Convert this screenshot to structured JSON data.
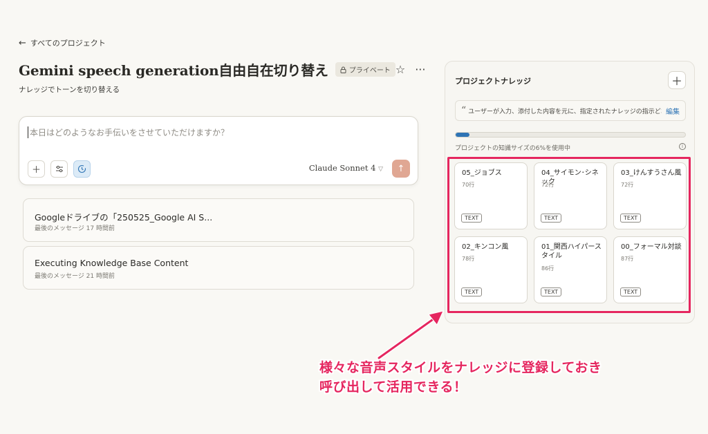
{
  "nav": {
    "back_label": "すべてのプロジェクト"
  },
  "project": {
    "title": "Gemini speech generation自由自在切り替え",
    "badge": "プライベート",
    "subtitle": "ナレッジでトーンを切り替える"
  },
  "composer": {
    "placeholder": "本日はどのようなお手伝いをさせていただけますか？",
    "model": "Claude Sonnet 4",
    "send_icon": "arrow-up-icon"
  },
  "chats": [
    {
      "title": "Googleドライブの「250525_Google AI S...",
      "meta": "最後のメッセージ 17 時間前"
    },
    {
      "title": "Executing Knowledge Base Content",
      "meta": "最後のメッセージ 21 時間前"
    }
  ],
  "knowledge": {
    "title": "プロジェクトナレッジ",
    "instruction": "ユーザーが入力、添付した内容を元に、指定されたナレッジの指示どおり出力...",
    "edit_label": "編集",
    "usage_percent": 6,
    "usage_text": "プロジェクトの知識サイズの6%を使用中",
    "files": [
      {
        "name": "05_ジョブス",
        "lines": "70行",
        "type": "TEXT"
      },
      {
        "name": "04_サイモン･シネック",
        "lines": "72行",
        "type": "TEXT"
      },
      {
        "name": "03_けんすうさん風",
        "lines": "72行",
        "type": "TEXT"
      },
      {
        "name": "02_キンコン風",
        "lines": "78行",
        "type": "TEXT"
      },
      {
        "name": "01_関西ハイパースタイル",
        "lines": "86行",
        "type": "TEXT"
      },
      {
        "name": "00_フォーマル対談",
        "lines": "87行",
        "type": "TEXT"
      }
    ]
  },
  "annotation": {
    "line1": "様々な音声スタイルをナレッジに登録しておき",
    "line2": "呼び出して活用できる！",
    "color": "#e5265f"
  },
  "colors": {
    "accent": "#2e74b5",
    "send": "#e0a793",
    "highlight": "#e5265f"
  }
}
